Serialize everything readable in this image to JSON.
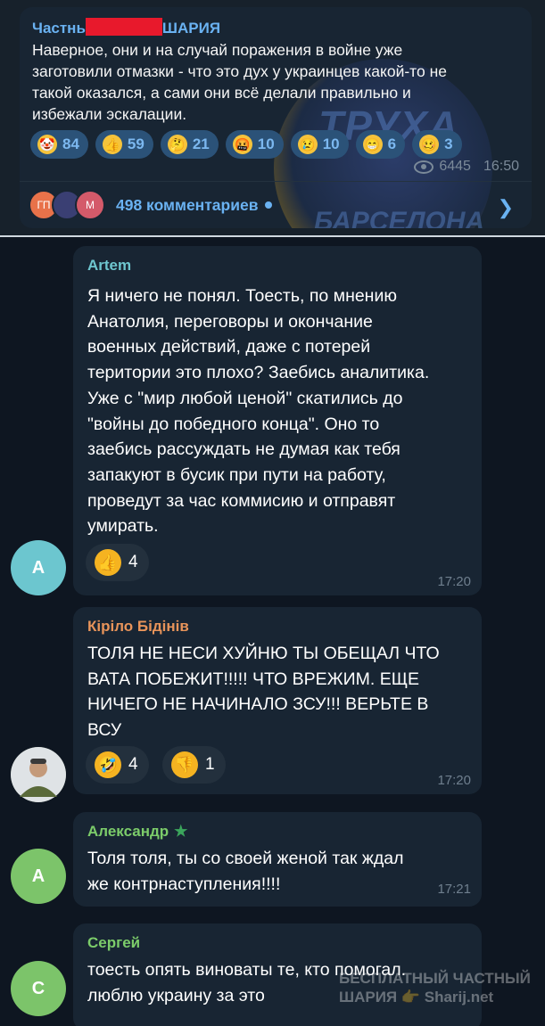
{
  "post": {
    "title_prefix": "Частнь",
    "title_suffix": "ШАРИЯ",
    "text": "Наверное, они и на случай поражения в войне уже\nзаготовили отмазки - что это дух у украинцев какой-то не\nтакой оказался, а сами они всё делали правильно и\nизбежали эскалации.",
    "reactions": [
      {
        "icon": "clown-emoji-icon",
        "glyph": "🤡",
        "count": "84"
      },
      {
        "icon": "thumbs-up-emoji-icon",
        "glyph": "👍",
        "count": "59"
      },
      {
        "icon": "thinking-emoji-icon",
        "glyph": "🤔",
        "count": "21"
      },
      {
        "icon": "cursing-face-emoji-icon",
        "glyph": "🤬",
        "count": "10"
      },
      {
        "icon": "crying-emoji-icon",
        "glyph": "😢",
        "count": "10"
      },
      {
        "icon": "grinning-emoji-icon",
        "glyph": "😁",
        "count": "6"
      },
      {
        "icon": "woozy-face-emoji-icon",
        "glyph": "🥴",
        "count": "3"
      }
    ],
    "views": "6445",
    "time": "16:50",
    "comment_avatars": [
      {
        "initials": "ГП",
        "color": "#e8724a"
      },
      {
        "initials": "",
        "color": "#3a3f73"
      },
      {
        "initials": "М",
        "color": "#d45a6a"
      }
    ],
    "comments_label": "498 комментариев",
    "watermark_top": "ТРУХА",
    "watermark_bottom": "БАРСЕЛОНА"
  },
  "comments": [
    {
      "author": "Artem",
      "author_color": "#6ec6cf",
      "avatar_initial": "A",
      "avatar_color": "#6cc6cf",
      "text": "Я ничего не понял. Тоесть, по мнению\nАнатолия, переговоры и окончание\nвоенных действий, даже с потерей\nтеритории это плохо? Заебись аналитика.\nУже с \"мир любой ценой\" скатились до\n\"войны до победного конца\". Оно то\nзаебись рассуждать не думая как тебя\nзапакуют в бусик при пути на работу,\nпроведут за час коммисию и отправят\nумирать.",
      "reactions": [
        {
          "icon": "thumbs-up-emoji-icon",
          "glyph": "👍",
          "count": "4"
        }
      ],
      "time": "17:20"
    },
    {
      "author": "Кіріло Бідінів",
      "author_color": "#e8945a",
      "avatar_initial": "",
      "avatar_color": "#5a6a4a",
      "text": "ТОЛЯ НЕ НЕСИ ХУЙНЮ ТЫ ОБЕЩАЛ ЧТО\nВАТА ПОБЕЖИТ!!!!! ЧТО ВРЕЖИМ. ЕЩЕ\nНИЧЕГО НЕ НАЧИНАЛО ЗСУ!!! ВЕРЬТЕ В\nВСУ",
      "reactions": [
        {
          "icon": "rolling-laughing-emoji-icon",
          "glyph": "🤣",
          "count": "4"
        },
        {
          "icon": "thumbs-down-emoji-icon",
          "glyph": "👎",
          "count": "1"
        }
      ],
      "time": "17:20"
    },
    {
      "author": "Александр",
      "author_color": "#7ccc6a",
      "avatar_initial": "A",
      "avatar_color": "#7cc46a",
      "text": "Толя толя, ты со своей женой так ждал\nже контрнаступления!!!!",
      "reactions": [],
      "time": "17:21"
    },
    {
      "author": "Сергей",
      "author_color": "#7ccc6a",
      "avatar_initial": "С",
      "avatar_color": "#7cc46a",
      "text": "тоесть опять виноваты те, кто помогал.\nлюблю украину за это",
      "reactions": [],
      "time": ""
    }
  ],
  "watermark_bottom": {
    "line1": "БЕСПЛАТНЫЙ ЧАСТНЫЙ",
    "line2": "ШАРИЯ 👉 Sharij.net"
  }
}
